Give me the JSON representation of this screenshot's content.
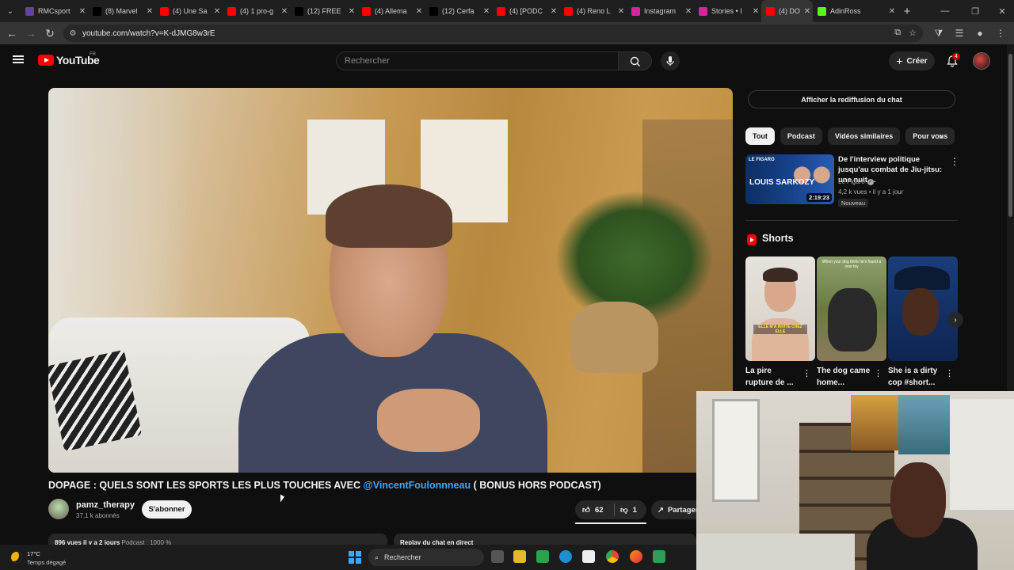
{
  "browser": {
    "tabs": [
      {
        "label": "RMCsport",
        "favicon_color": "#6441a5",
        "active": false
      },
      {
        "label": "(8) Marvel",
        "favicon_color": "#000000",
        "active": false
      },
      {
        "label": "(4) Une Sa",
        "favicon_color": "#ff0000",
        "active": false
      },
      {
        "label": "(4) 1 pro-g",
        "favicon_color": "#ff0000",
        "active": false
      },
      {
        "label": "(12) FREE",
        "favicon_color": "#000000",
        "active": false
      },
      {
        "label": "(4) Allema",
        "favicon_color": "#ff0000",
        "active": false
      },
      {
        "label": "(12) Cerfa",
        "favicon_color": "#000000",
        "active": false
      },
      {
        "label": "(4) [PODC",
        "favicon_color": "#ff0000",
        "active": false
      },
      {
        "label": "(4) Reno L",
        "favicon_color": "#ff0000",
        "active": false
      },
      {
        "label": "Instagram",
        "favicon_color": "#d6249f",
        "active": false
      },
      {
        "label": "Stories • I",
        "favicon_color": "#d6249f",
        "active": false
      },
      {
        "label": "(4) DO",
        "favicon_color": "#ff0000",
        "active": true
      },
      {
        "label": "AdinRoss",
        "favicon_color": "#53fc18",
        "active": false
      }
    ],
    "url": "youtube.com/watch?v=K-dJMG8w3rE"
  },
  "header": {
    "logo_text": "YouTube",
    "region": "FR",
    "search_placeholder": "Rechercher",
    "create_label": "Créer",
    "notification_count": "4"
  },
  "video": {
    "title_part1": "DOPAGE : QUELS SONT LES SPORTS LES PLUS TOUCHES AVEC ",
    "title_mention": "@VincentFoulonnneau",
    "title_part2": " ( BONUS HORS PODCAST)",
    "channel_name": "pamz_therapy",
    "channel_subs": "37,1 k abonnés",
    "subscribe_label": "S'abonner",
    "likes": "62",
    "dislikes": "1",
    "share_label": "Partager",
    "description_stats": "896 vues  il y a 2 jours",
    "description_tags": "Podcast : 1000 %",
    "chat_replay_box_label": "Replay du chat en direct"
  },
  "sidebar": {
    "chat_replay_button": "Afficher la rediffusion du chat",
    "chips": [
      "Tout",
      "Podcast",
      "Vidéos similaires",
      "Pour vous"
    ],
    "recommendation": {
      "title": "De l'interview politique jusqu'au combat de Jiu-jitsu: une nuit ...",
      "channel": "Le Figaro",
      "meta": "4,2 k vues • il y a 1 jour",
      "badge": "Nouveau",
      "duration": "2:19:23",
      "thumb_brand": "LE FIGARO",
      "thumb_text": "LOUIS SARKOZY"
    },
    "shorts_heading": "Shorts",
    "shorts": [
      {
        "title": "La pire rupture de ...",
        "caption": "ELLE M'A INVITÉ CHEZ ELLE"
      },
      {
        "title": "The dog came home...",
        "caption": "When your dog think he's found a new toy"
      },
      {
        "title": "She is a dirty cop #short...",
        "caption": ""
      }
    ]
  },
  "taskbar": {
    "temperature": "17°C",
    "weather": "Temps dégagé",
    "search_label": "Rechercher"
  }
}
